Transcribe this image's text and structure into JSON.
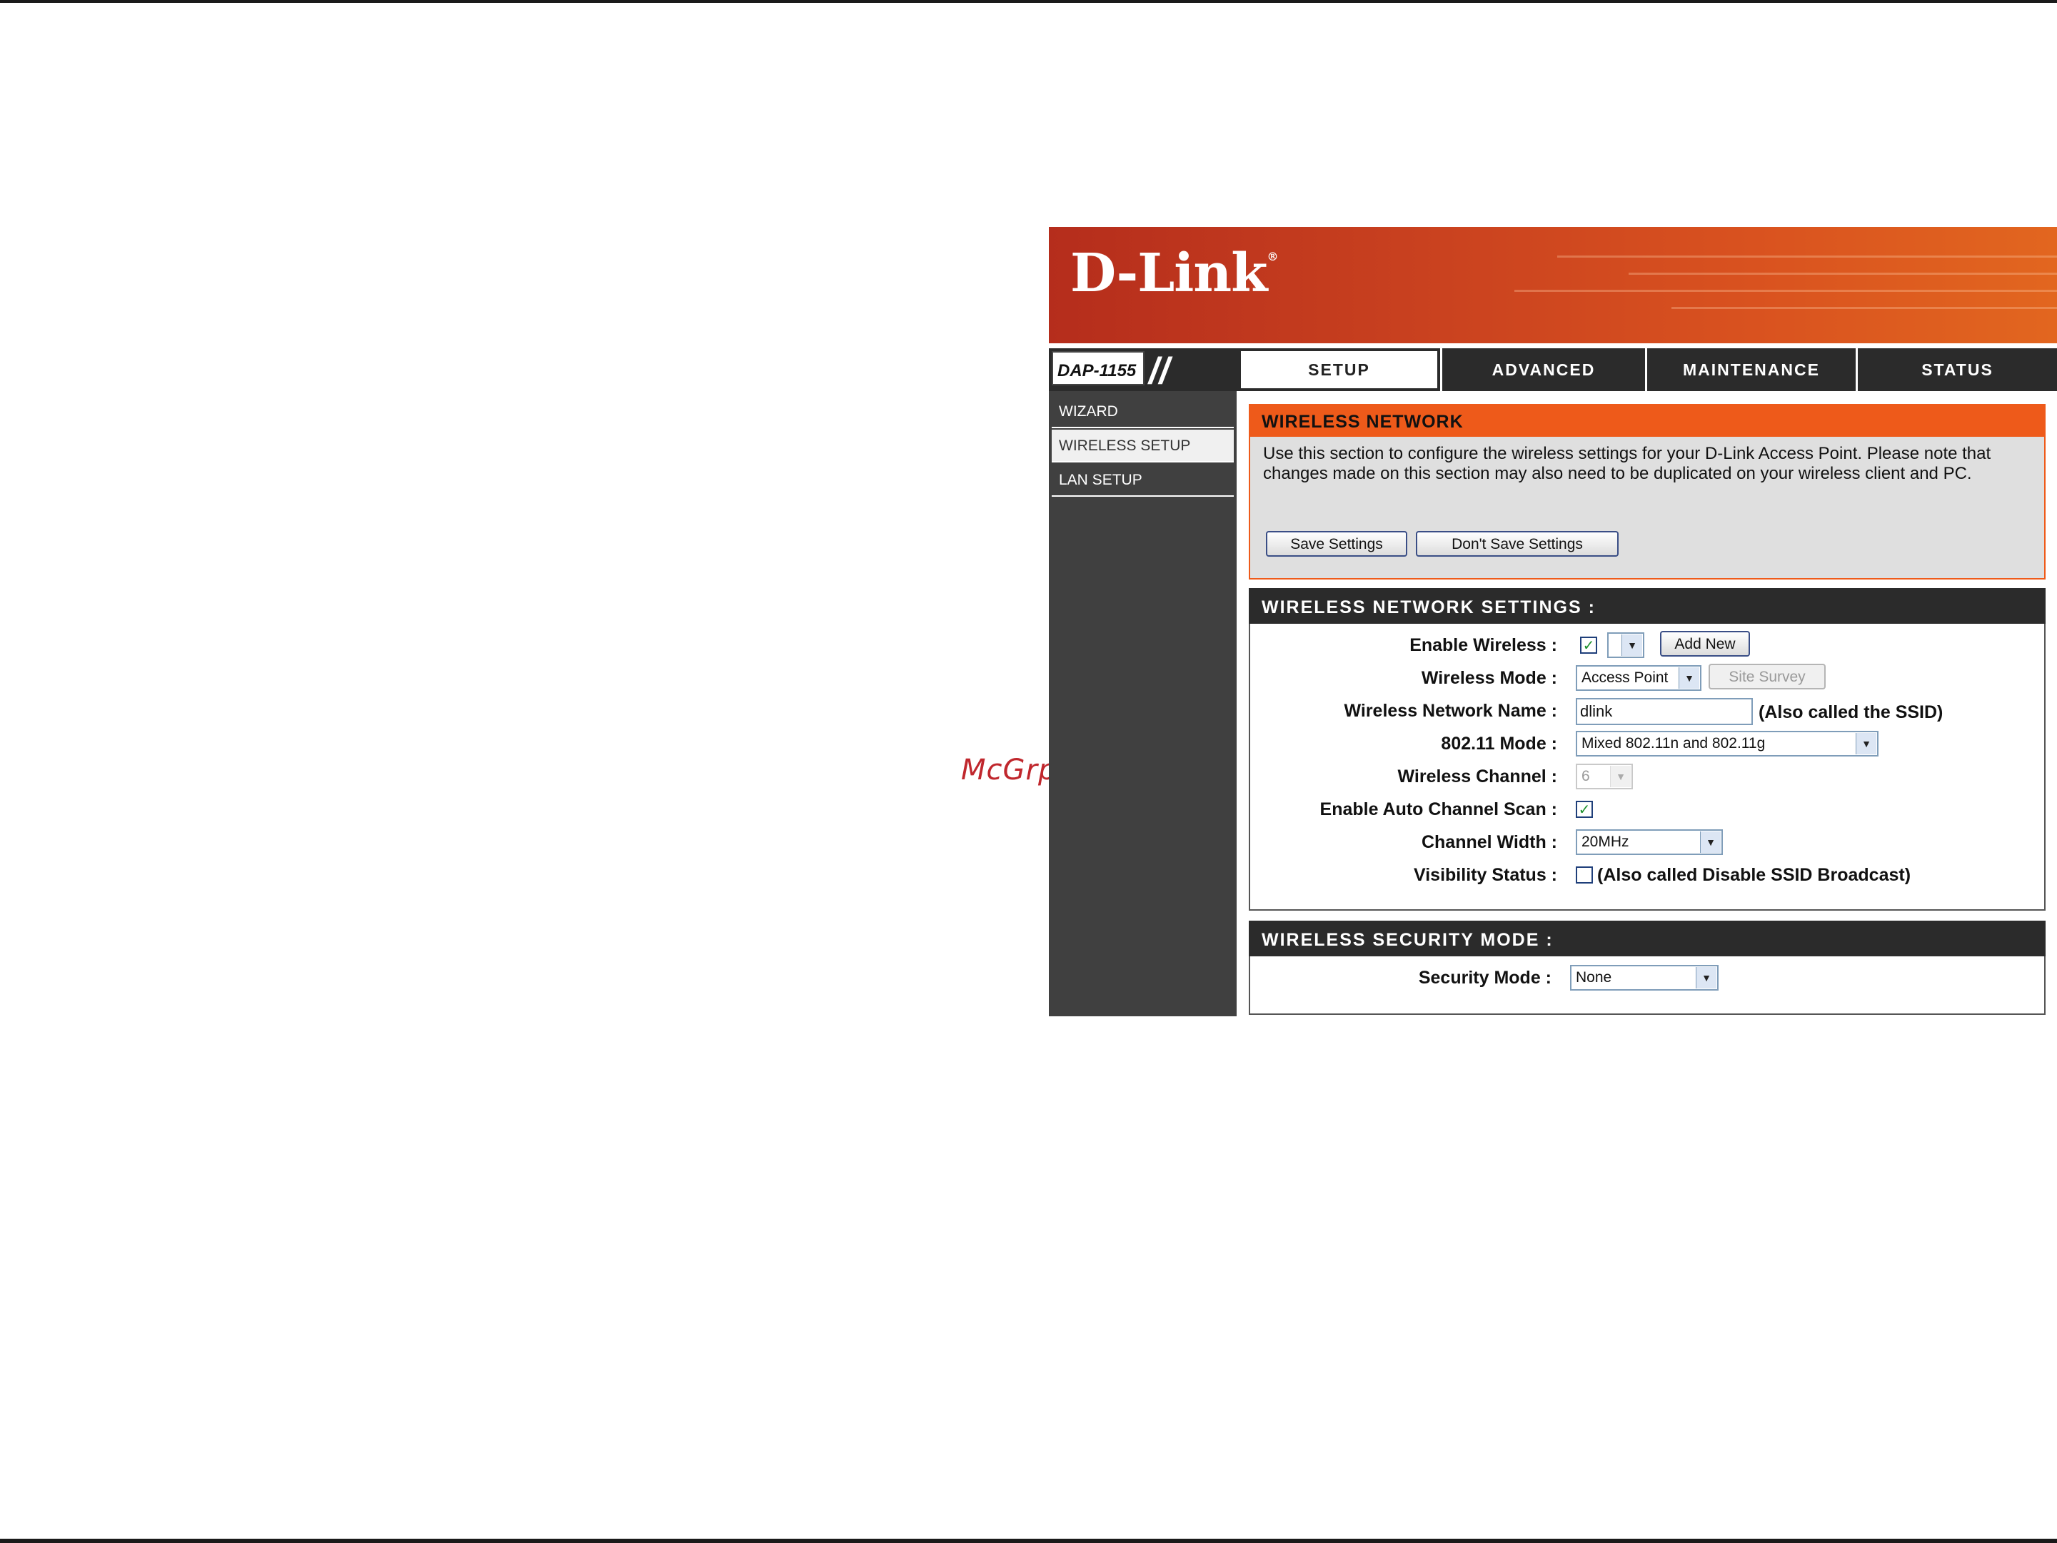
{
  "watermark": "McGrp.Ru",
  "brand": {
    "logo": "D-Link",
    "registered": "®",
    "model": "DAP-1155",
    "separator": "//"
  },
  "tabs": [
    {
      "label": "SETUP"
    },
    {
      "label": "ADVANCED"
    },
    {
      "label": "MAINTENANCE"
    },
    {
      "label": "STATUS"
    }
  ],
  "sidebar": {
    "items": [
      {
        "label": "WIZARD"
      },
      {
        "label": "WIRELESS SETUP"
      },
      {
        "label": "LAN SETUP"
      }
    ],
    "active": "WIRELESS SETUP"
  },
  "wireless_network": {
    "title": "WIRELESS NETWORK",
    "description": "Use this section to configure the wireless settings for your D-Link Access Point. Please note that changes made on this section may also need to be duplicated on your wireless client and PC.",
    "save_label": "Save Settings",
    "dont_save_label": "Don't Save Settings"
  },
  "settings": {
    "title": "WIRELESS NETWORK SETTINGS :",
    "enable_wireless_label": "Enable Wireless :",
    "enable_wireless_checked": true,
    "schedule_value": "",
    "add_new_label": "Add New",
    "wireless_mode_label": "Wireless Mode :",
    "wireless_mode_value": "Access Point",
    "site_survey_label": "Site Survey",
    "network_name_label": "Wireless Network Name :",
    "network_name_value": "dlink",
    "network_name_note": "(Also called the SSID)",
    "mode_80211_label": "802.11 Mode :",
    "mode_80211_value": "Mixed 802.11n and 802.11g",
    "channel_label": "Wireless Channel :",
    "channel_value": "6",
    "auto_scan_label": "Enable Auto Channel Scan :",
    "auto_scan_checked": true,
    "channel_width_label": "Channel Width :",
    "channel_width_value": "20MHz",
    "visibility_label": "Visibility Status :",
    "visibility_checked": false,
    "visibility_note": "(Also called Disable SSID Broadcast)"
  },
  "security": {
    "title": "WIRELESS SECURITY MODE :",
    "mode_label": "Security Mode :",
    "mode_value": "None"
  },
  "icons": {
    "dropdown": "chevron-down-icon",
    "checkmark": "checkmark-icon"
  },
  "colors": {
    "banner": "#c8401f",
    "orange_header": "#ee5a1a",
    "dark": "#2b2b2b",
    "sidebar": "#404040"
  }
}
